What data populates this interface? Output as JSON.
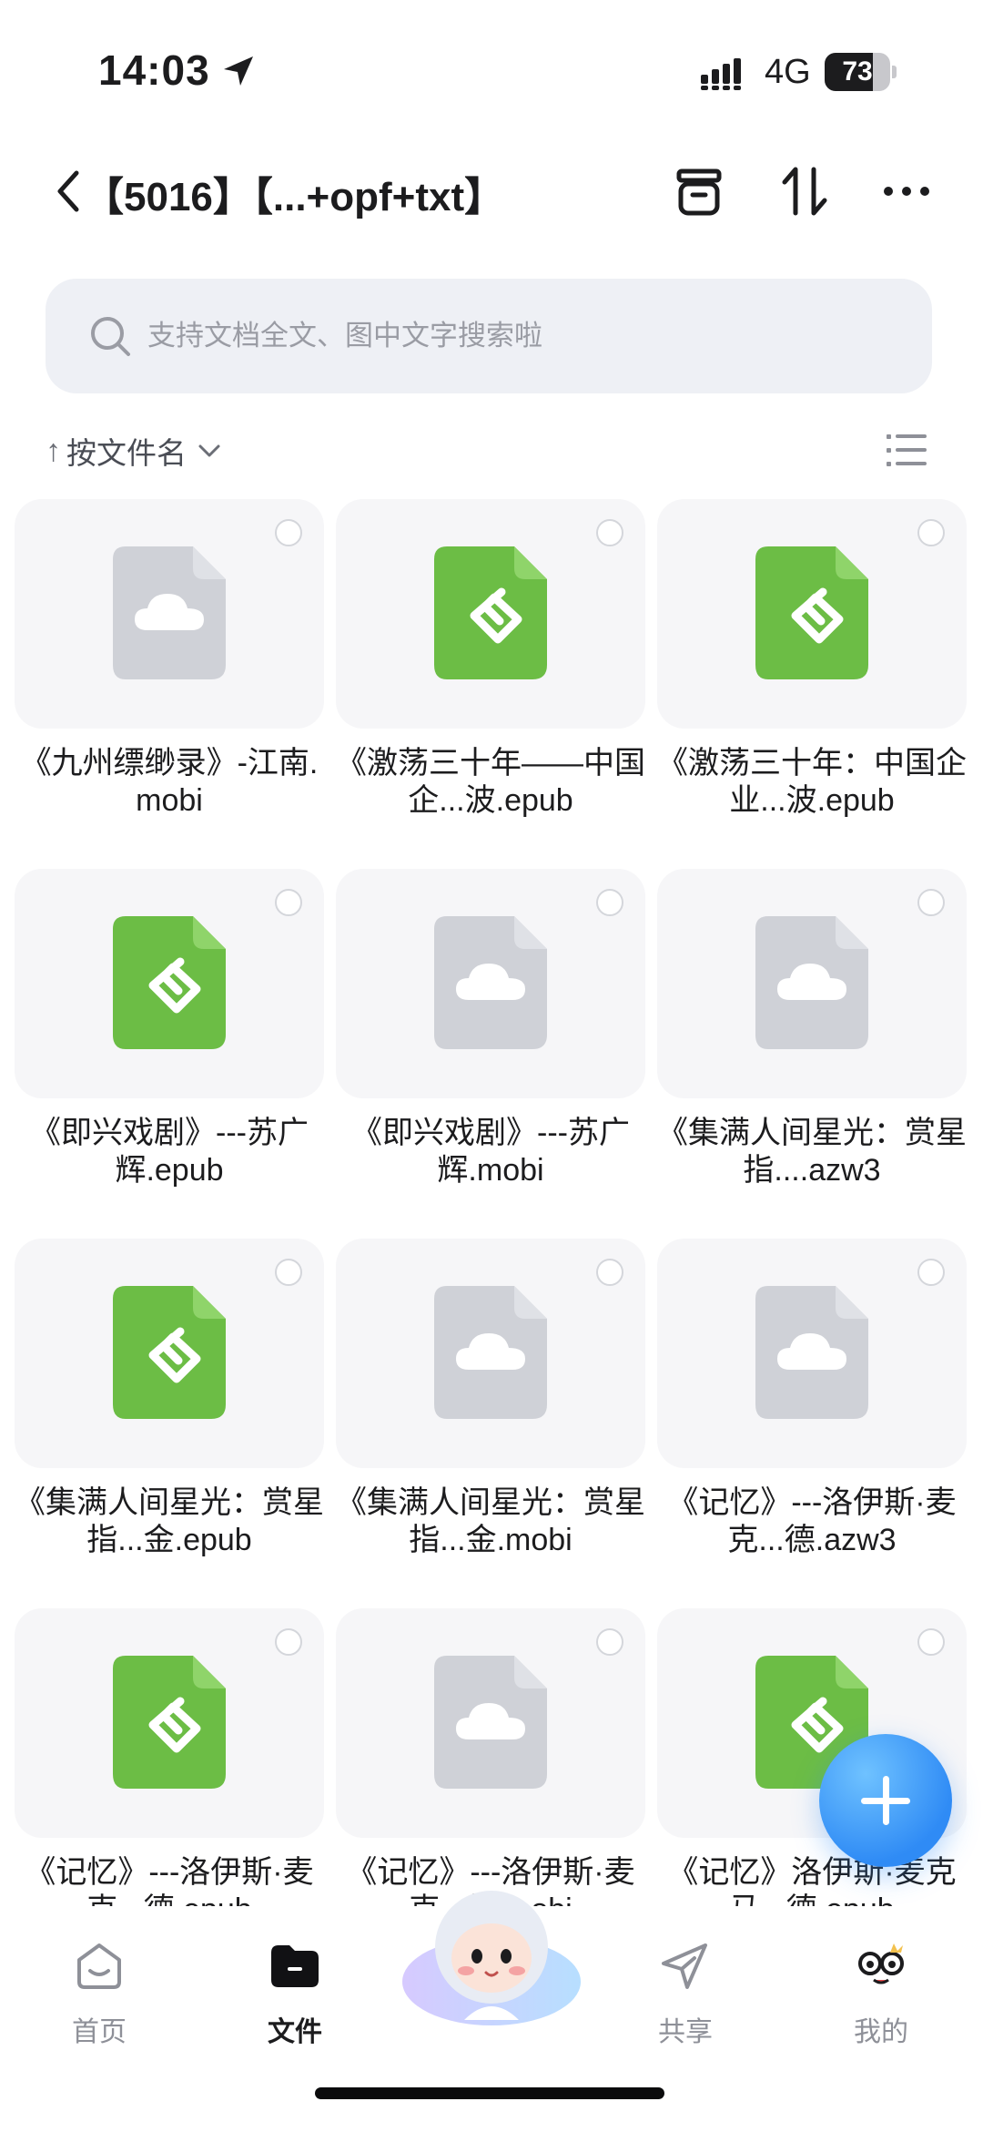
{
  "status_bar": {
    "time": "14:03",
    "network": "4G",
    "battery": "73",
    "battery_level": 0.73
  },
  "nav": {
    "title": "【5016】【...+opf+txt】"
  },
  "search": {
    "placeholder": "支持文档全文、图中文字搜索啦"
  },
  "sort": {
    "arrow": "↑",
    "label": "按文件名"
  },
  "files": [
    {
      "name": "《九州缥缈录》-江南.mobi",
      "icon": "cloud-file-icon"
    },
    {
      "name": "《激荡三十年——中国企...波.epub",
      "icon": "epub-file-icon"
    },
    {
      "name": "《激荡三十年：中国企业...波.epub",
      "icon": "epub-file-icon"
    },
    {
      "name": "《即兴戏剧》---苏广辉.epub",
      "icon": "epub-file-icon"
    },
    {
      "name": "《即兴戏剧》---苏广辉.mobi",
      "icon": "cloud-file-icon"
    },
    {
      "name": "《集满人间星光：赏星指....azw3",
      "icon": "cloud-file-icon"
    },
    {
      "name": "《集满人间星光：赏星指...金.epub",
      "icon": "epub-file-icon"
    },
    {
      "name": "《集满人间星光：赏星指...金.mobi",
      "icon": "cloud-file-icon"
    },
    {
      "name": "《记忆》---洛伊斯·麦克...德.azw3",
      "icon": "cloud-file-icon"
    },
    {
      "name": "《记忆》---洛伊斯·麦克...德.epub",
      "icon": "epub-file-icon"
    },
    {
      "name": "《记忆》---洛伊斯·麦克...德.mobi",
      "icon": "cloud-file-icon"
    },
    {
      "name": "《记忆》洛伊斯·麦克马...德.epub",
      "icon": "epub-file-icon"
    }
  ],
  "tabs": [
    {
      "label": "首页",
      "icon": "home-icon"
    },
    {
      "label": "文件",
      "icon": "folder-icon"
    },
    {
      "label": "共享",
      "icon": "send-icon"
    },
    {
      "label": "我的",
      "icon": "profile-mascot-icon"
    }
  ],
  "colors": {
    "epub_green": "#6cbd45",
    "cloud_gray": "#cfd1d7",
    "accent_blue": "#2f8bf5"
  }
}
